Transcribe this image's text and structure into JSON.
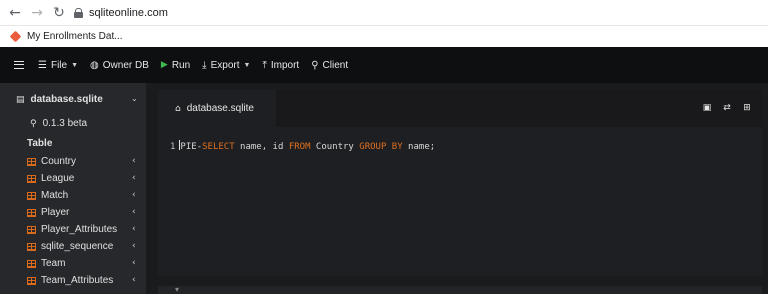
{
  "browser": {
    "url": "sqliteonline.com",
    "bookmark_label": "My Enrollments Dat..."
  },
  "toolbar": {
    "file_label": "File",
    "owner_label": "Owner DB",
    "run_label": "Run",
    "export_label": "Export",
    "import_label": "Import",
    "client_label": "Client"
  },
  "sidebar": {
    "db_name": "database.sqlite",
    "version": "0.1.3 beta",
    "table_heading": "Table",
    "tables": [
      {
        "label": "Country"
      },
      {
        "label": "League"
      },
      {
        "label": "Match"
      },
      {
        "label": "Player"
      },
      {
        "label": "Player_Attributes"
      },
      {
        "label": "sqlite_sequence"
      },
      {
        "label": "Team"
      },
      {
        "label": "Team_Attributes"
      }
    ]
  },
  "editor": {
    "tab_label": "database.sqlite",
    "line_number": "1",
    "code_prefix": "PIE-",
    "kw_select": "SELECT",
    "code_cols": " name, id ",
    "kw_from": "FROM",
    "code_table": " Country ",
    "kw_group": "GROUP BY",
    "code_tail": " name;"
  },
  "colors": {
    "accent_orange": "#e0701f",
    "run_green": "#3fb950",
    "toolbar_bg": "#0e0f11",
    "sidebar_bg": "#26282b"
  }
}
